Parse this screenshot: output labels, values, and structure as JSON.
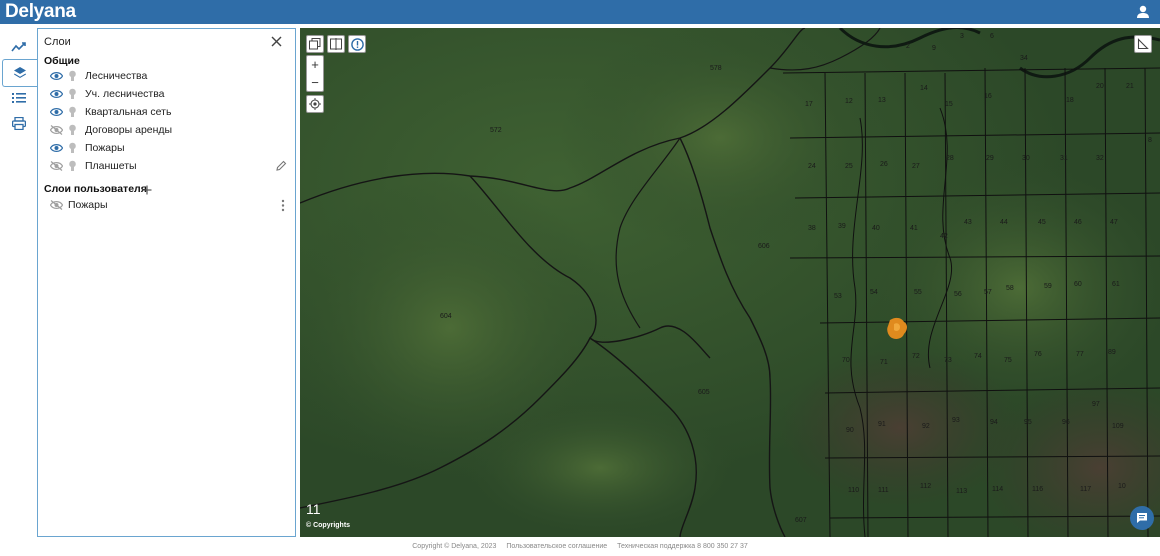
{
  "app": {
    "logo": "Delyana"
  },
  "panel": {
    "title": "Слои",
    "general_section": "Общие",
    "layers": [
      {
        "label": "Лесничества",
        "visible": true
      },
      {
        "label": "Уч. лесничества",
        "visible": true
      },
      {
        "label": "Квартальная сеть",
        "visible": true
      },
      {
        "label": "Договоры аренды",
        "visible": false
      },
      {
        "label": "Пожары",
        "visible": true
      },
      {
        "label": "Планшеты",
        "visible": false
      }
    ],
    "user_section": "Слои пользователя",
    "user_layers": [
      {
        "label": "Пожары",
        "visible": false
      }
    ]
  },
  "map": {
    "zoom_level": "11",
    "copyrights": "© Copyrights",
    "zoom_in": "+",
    "zoom_out": "−",
    "plot_labels": [
      "578",
      "572",
      "606",
      "604",
      "605",
      "607",
      "17",
      "12",
      "13",
      "14",
      "15",
      "16",
      "18",
      "20",
      "21",
      "24",
      "25",
      "26",
      "27",
      "28",
      "29",
      "30",
      "31",
      "32",
      "38",
      "39",
      "40",
      "41",
      "42",
      "43",
      "44",
      "45",
      "46",
      "47",
      "53",
      "54",
      "55",
      "56",
      "57",
      "58",
      "59",
      "60",
      "61",
      "70",
      "71",
      "72",
      "73",
      "74",
      "75",
      "76",
      "77",
      "89",
      "90",
      "91",
      "92",
      "93",
      "94",
      "95",
      "96",
      "97",
      "109",
      "110",
      "111",
      "112",
      "113",
      "114",
      "116",
      "117",
      "10",
      "34",
      "8",
      "9",
      "2",
      "3",
      "6"
    ]
  },
  "footer": {
    "copyright": "Copyright © Delyana, 2023",
    "agreement": "Пользовательское соглашение",
    "support": "Техническая поддержка 8 800 350 27 37"
  },
  "colors": {
    "brand": "#2f6da8",
    "panel_border": "#6aa5d0",
    "fire": "#e08a1e"
  }
}
